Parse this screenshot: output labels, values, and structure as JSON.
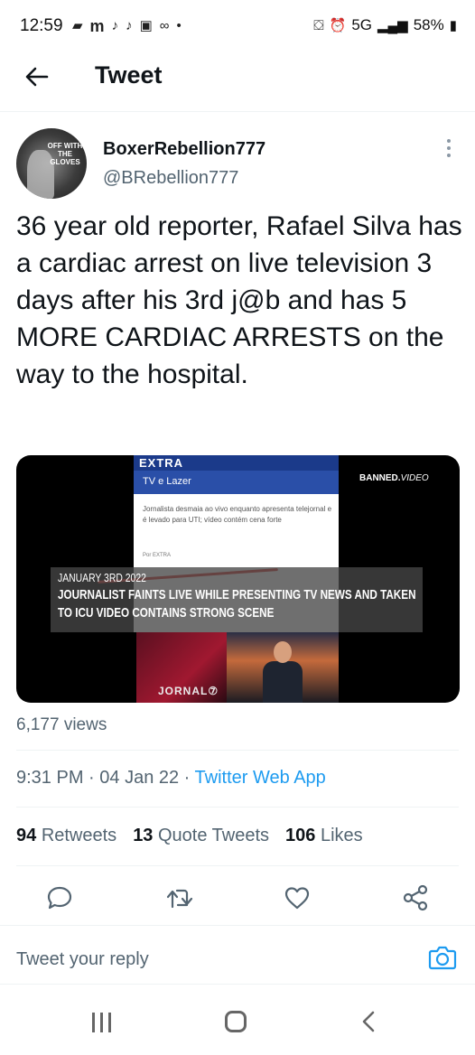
{
  "status_bar": {
    "time": "12:59",
    "left_icons": [
      "message-icon",
      "m-icon",
      "tiktok-icon",
      "tiktok-icon",
      "abc-icon",
      "voicemail-icon",
      "dot-icon"
    ],
    "network": "5G",
    "battery": "58%"
  },
  "header": {
    "title": "Tweet"
  },
  "tweet": {
    "display_name": "BoxerRebellion777",
    "handle": "@BRebellion777",
    "avatar_text": "OFF WITH THE GLOVES",
    "text": "36 year old reporter, Rafael Silva has a cardiac arrest on live television 3 days after his 3rd j@b and has 5 MORE CARDIAC ARRESTS on the way to the hospital.",
    "media": {
      "logo": "EXTRA",
      "section": "TV e Lazer",
      "article_text": "Jornalista desmaia ao vivo enquanto apresenta telejornal e é levado para UTI; vídeo contém cena forte",
      "byline": "Por EXTRA",
      "watermark_bold": "BANNED.",
      "watermark_light": "VIDEO",
      "caption_date": "JANUARY 3RD 2022",
      "caption_line1": "JOURNALIST FAINTS LIVE WHILE PRESENTING TV NEWS AND TAKEN",
      "caption_line2": "TO ICU VIDEO CONTAINS STRONG SCENE",
      "channel_label": "JORNAL⑦"
    },
    "views": "6,177 views",
    "time": "9:31 PM",
    "date": "04 Jan 22",
    "source_app": "Twitter Web App",
    "stats": {
      "retweets_count": "94",
      "retweets_label": "Retweets",
      "quotes_count": "13",
      "quotes_label": "Quote Tweets",
      "likes_count": "106",
      "likes_label": "Likes"
    }
  },
  "reply": {
    "placeholder": "Tweet your reply"
  },
  "colors": {
    "accent": "#1d9bf0",
    "text": "#0f1419",
    "muted": "#536471"
  }
}
